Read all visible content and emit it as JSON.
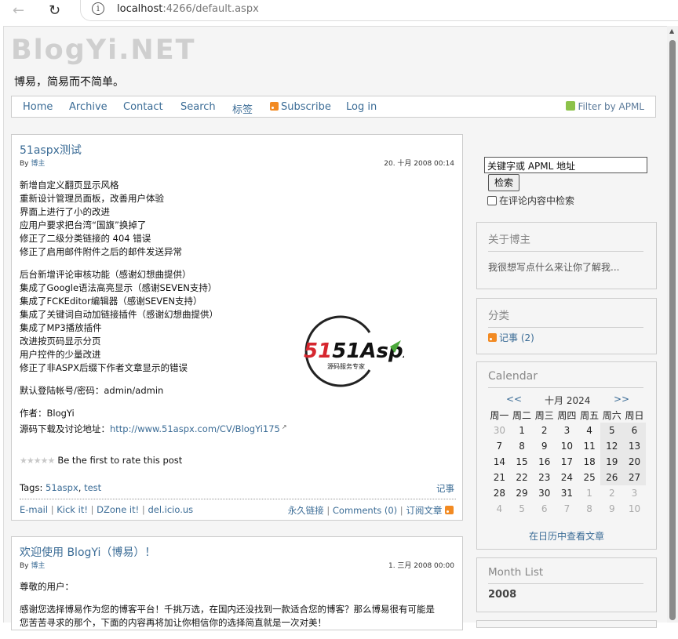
{
  "browser": {
    "url_host": "localhost",
    "url_path": ":4266/default.aspx"
  },
  "site": {
    "title": "BlogYi.NET",
    "slogan": "博易，简易而不简单。"
  },
  "menu": {
    "items": [
      "Home",
      "Archive",
      "Contact",
      "Search",
      "标签"
    ],
    "subscribe": "Subscribe",
    "login": "Log in",
    "apml": "Filter by APML"
  },
  "post1": {
    "title": "51aspx测试",
    "by_label": "By",
    "author": "博主",
    "date": "20. 十月 2008 00:14",
    "para1": [
      "新增自定义翻页显示风格",
      "重新设计管理员面板，改善用户体验",
      "界面上进行了小的改进",
      "应用户要求把台湾“国旗”换掉了",
      "修正了二级分类链接的 404 错误",
      "修正了启用邮件附件之后的邮件发送异常"
    ],
    "para2": [
      "后台新增评论审核功能（感谢幻想曲提供）",
      "集成了Google语法高亮显示（感谢SEVEN支持）",
      "集成了FCKEditor编辑器（感谢SEVEN支持）",
      "集成了关键词自动加链接插件（感谢幻想曲提供）",
      "集成了MP3播放插件",
      "改进按页码显示分页",
      "用户控件的少量改进",
      "修正了非ASPX后缀下作者文章显示的错误"
    ],
    "login_info": "默认登陆帐号/密码：admin/admin",
    "author_line": "作者：BlogYi",
    "download_label": "源码下载及讨论地址：",
    "download_url": "http://www.51aspx.com/CV/BlogYi175",
    "logo_text": "51Aspx",
    "logo_sub": "源码服务专家",
    "rating_text": "Be the first to rate this post",
    "tags_label": "Tags:",
    "tags": [
      "51aspx",
      "test"
    ],
    "category": "记事",
    "share": [
      "E-mail",
      "Kick it!",
      "DZone it!",
      "del.icio.us"
    ],
    "permalink": "永久链接",
    "comments": "Comments (0)",
    "subscribe": "订阅文章"
  },
  "post2": {
    "title": "欢迎使用 BlogYi（博易）！",
    "by_label": "By",
    "author": "博主",
    "date": "1. 三月 2008 00:00",
    "greeting": "尊敬的用户：",
    "line1": "感谢您选择博易作为您的博客平台！千挑万选，在国内还没找到一款适合您的博客？那么博易很有可能是",
    "line2": "您苦苦寻求的那个，下面的内容再将加让你相信你的选择简直就是一次对美！"
  },
  "sidebar": {
    "search_value": "关键字或 APML 地址",
    "search_button": "检索",
    "search_comments": "在评论内容中检索",
    "about_title": "关于博主",
    "about_text": "我很想写点什么来让你了解我...",
    "cats_title": "分类",
    "cats_item": "记事 (2)",
    "cal_title": "Calendar",
    "cal_prev": "<<",
    "cal_month": "十月 2024",
    "cal_next": ">>",
    "cal_weekdays": [
      "周一",
      "周二",
      "周三",
      "周四",
      "周五",
      "周六",
      "周日"
    ],
    "cal_weeks": [
      [
        "30",
        "1",
        "2",
        "3",
        "4",
        "5",
        "6"
      ],
      [
        "7",
        "8",
        "9",
        "10",
        "11",
        "12",
        "13"
      ],
      [
        "14",
        "15",
        "16",
        "17",
        "18",
        "19",
        "20"
      ],
      [
        "21",
        "22",
        "23",
        "24",
        "25",
        "26",
        "27"
      ],
      [
        "28",
        "29",
        "30",
        "31",
        "1",
        "2",
        "3"
      ],
      [
        "4",
        "5",
        "6",
        "7",
        "8",
        "9",
        "10"
      ]
    ],
    "cal_link": "在日历中查看文章",
    "months_title": "Month List",
    "months_item": "2008"
  },
  "colors": {
    "link": "#3b6c96",
    "title_gray": "#cfcfcf",
    "rss_orange": "#f28a22",
    "logo_red": "#d6272f",
    "logo_green": "#4aa83a"
  }
}
